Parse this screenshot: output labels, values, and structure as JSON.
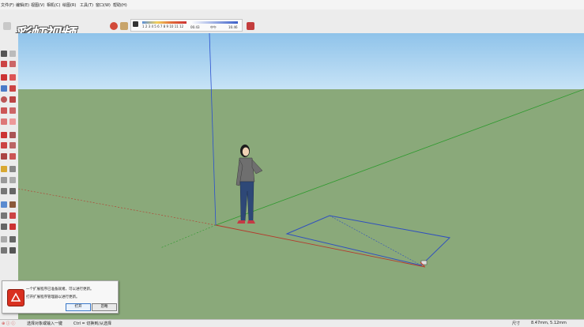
{
  "menubar": {
    "items": [
      {
        "label": "文件(F)"
      },
      {
        "label": "编辑(E)"
      },
      {
        "label": "视图(V)"
      },
      {
        "label": "相机(C)"
      },
      {
        "label": "绘图(R)"
      },
      {
        "label": "工具(T)"
      },
      {
        "label": "窗口(W)"
      },
      {
        "label": "帮助(H)"
      }
    ]
  },
  "watermark": {
    "text": "彩虹视频"
  },
  "shadow_panel": {
    "months": "1 2 3 4 5 6 7 8 9 10 11 12",
    "time_start": "06:43",
    "time_mid": "中午",
    "time_end": "16:46"
  },
  "dialog": {
    "line1": "一个扩展程序已准备就绪，可以进行更新。",
    "line2": "打开扩展程序管理器以进行更新。",
    "open_label": "打开",
    "close_label": "忽略"
  },
  "statusbar": {
    "hint": "选择对象或输入一键",
    "ctrl_hint": "Ctrl = 切换到/从选择",
    "measure_label": "尺寸",
    "measure_value": "8.47mm, 5.12mm"
  },
  "colors": {
    "sky": "#aed6f1",
    "ground": "#8aa97a",
    "axis_red": "#b5392c",
    "axis_green": "#2e9a2e",
    "axis_blue": "#2a4fcf",
    "rect_edges": "#2f4fbf"
  }
}
